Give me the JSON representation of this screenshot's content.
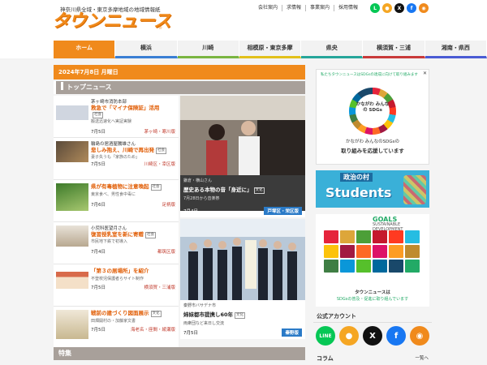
{
  "header": {
    "tagline": "神奈川県全域・東京多摩地域の地域情報紙",
    "logo_text": "タウンニュース",
    "logo_mark": "®",
    "top_links": [
      "会社案内",
      "求情報",
      "事業案内",
      "採用情報"
    ],
    "social": [
      {
        "icon": "line-icon",
        "glyph": "L",
        "color": "#06c755"
      },
      {
        "icon": "kakao-icon",
        "glyph": "●",
        "color": "#f5a623"
      },
      {
        "icon": "x-icon",
        "glyph": "X",
        "color": "#111111"
      },
      {
        "icon": "facebook-icon",
        "glyph": "f",
        "color": "#1877f2"
      },
      {
        "icon": "rss-icon",
        "glyph": "◉",
        "color": "#f08a1c"
      }
    ]
  },
  "nav": {
    "items": [
      "ホーム",
      "横浜",
      "川崎",
      "相模原・東京多摩",
      "県央",
      "横須賀・三浦",
      "湘南・県西"
    ]
  },
  "main": {
    "date": "2024年7月8日 月曜日",
    "section_title": "トップニュース",
    "news": [
      {
        "sub": "茅ヶ崎市消防本部",
        "title": "救急で「マイナ保険証」活用",
        "badge": "社会",
        "desc": "搬送迅速化へ実証実験",
        "date": "7月5日",
        "area": "茅ヶ崎・寒川版"
      },
      {
        "sub": "輪島の居酒屋騰雄さん",
        "title": "悲しみ抱え、川崎で再出発",
        "badge": "社会",
        "desc": "妻子失うも「家族のため」",
        "date": "7月5日",
        "area": "川崎区・幸区版"
      },
      {
        "sub": "",
        "title": "県が有毒植物に注意喚起",
        "badge": "社会",
        "desc": "東京食べ、男性食中毒に",
        "date": "7月6日",
        "area": "足柄版"
      },
      {
        "sub": "小児科医望月さん",
        "title": "復習授乳室を新に寄贈",
        "badge": "社会",
        "desc": "市民地下鉄で初導入",
        "date": "7月4日",
        "area": "都筑区版"
      },
      {
        "sub": "",
        "title": "「第３の居場所」を紹介",
        "badge": "社会",
        "desc": "不登校児保護者らサイト制作",
        "date": "7月5日",
        "area": "横須賀・三浦版"
      },
      {
        "sub": "",
        "title": "戦前の建づくり図面展示",
        "badge": "文化",
        "desc": "田畑開村の・加藤家文書",
        "date": "7月5日",
        "area": "海老名・座間・綾瀬版"
      }
    ],
    "featured": [
      {
        "small": "鎌倉・横山さん",
        "title": "歴史ある本物の音「身近に」",
        "badge": "文化",
        "desc": "7月28日から音楽祭",
        "date": "7月4日",
        "chip": "戸塚区・栄区版"
      },
      {
        "small": "秦野市バサデナ市",
        "title": "姉妹都市提携し60年",
        "badge": "文化",
        "desc": "両衆団など来日し交流",
        "date": "7月5日",
        "chip": "秦野版"
      }
    ],
    "special_title": "特集"
  },
  "sidebar": {
    "sdgs_top": "私たちタウンニュースはSDGsの達成に向けて取り組みます",
    "sdgs_inner": "かながわ みんなの SDGs",
    "sdgs_cap1": "かながわ みんなのSDGsの",
    "sdgs_cap2": "取り組みを応援しています",
    "students_pl": "政治の村",
    "students_st": "Students",
    "goals_head_small": "SUSTAINABLE DEVELOPMENT",
    "goals_head_big": "GOALS",
    "goals_cap1": "タウンニュースは",
    "goals_cap2": "SDGsの普及・促進に取り組んでいます",
    "goal_colors": [
      "#e5243b",
      "#dda63a",
      "#4c9f38",
      "#c5192d",
      "#ff3a21",
      "#26bde2",
      "#fcc30b",
      "#a21942",
      "#fd6925",
      "#dd1367",
      "#fd9d24",
      "#bf8b2e",
      "#3f7e44",
      "#0a97d9",
      "#56c02b",
      "#00689d",
      "#19486a",
      "#2a6"
    ],
    "accounts_title": "公式アカウント",
    "accounts": [
      {
        "icon": "line-icon",
        "glyph": "LINE",
        "color": "#06c755"
      },
      {
        "icon": "kakao-icon",
        "glyph": "●",
        "color": "#f5a623"
      },
      {
        "icon": "x-icon",
        "glyph": "X",
        "color": "#111111"
      },
      {
        "icon": "facebook-icon",
        "glyph": "f",
        "color": "#1877f2"
      },
      {
        "icon": "rss-icon",
        "glyph": "◉",
        "color": "#f08a1c"
      }
    ],
    "column_title": "コラム",
    "column_more": "一覧へ"
  }
}
